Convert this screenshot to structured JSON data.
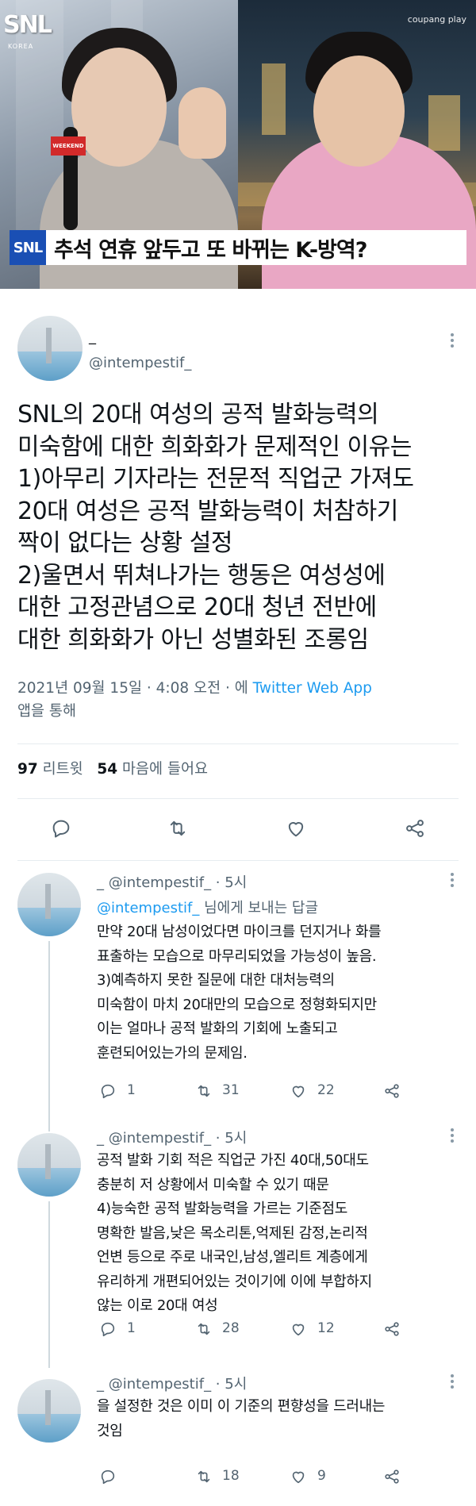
{
  "header_image": {
    "show_logo": "SNL",
    "show_logo_sub": "KOREA",
    "platform_watermark": "coupang play",
    "mic_flag": "WEEKEND",
    "caption_badge": "SNL",
    "caption": "추석 연휴 앞두고 또 바뀌는 K-방역?"
  },
  "tweet": {
    "display_name": "_",
    "handle": "@intempestif_",
    "text_lines": [
      "SNL의 20대 여성의 공적 발화능력의",
      "미숙함에 대한 희화화가 문제적인 이유는",
      "1)아무리 기자라는 전문적 직업군 가져도",
      "20대 여성은 공적 발화능력이 처참하기",
      "짝이 없다는 상황 설정",
      "2)울면서 뛰쳐나가는 행동은 여성성에",
      "대한 고정관념으로 20대 청년 전반에",
      "대한 희화화가 아닌 성별화된 조롱임"
    ],
    "timestamp": "2021년 09월 15일 · 4:08 오전 · 에",
    "app": "Twitter Web App",
    "app_suffix": "앱을 통해",
    "retweets": "97",
    "retweets_label": "리트윗",
    "likes": "54",
    "likes_label": "마음에 들어요"
  },
  "replies": [
    {
      "header": "_ @intempestif_ · 5시",
      "reply_to_mention": "@intempestif_",
      "reply_to_suffix": "님에게 보내는 답글",
      "lines": [
        "만약 20대 남성이었다면 마이크를 던지거나 화를",
        "표출하는 모습으로 마무리되었을 가능성이 높음.",
        "3)예측하지 못한 질문에 대한 대처능력의",
        "미숙함이 마치 20대만의 모습으로 정형화되지만",
        "이는 얼마나 공적 발화의 기회에 노출되고",
        "훈련되어있는가의 문제임."
      ],
      "replies": "1",
      "retweets": "31",
      "likes": "22"
    },
    {
      "header": "_ @intempestif_ · 5시",
      "lines": [
        "공적 발화 기회 적은 직업군 가진 40대,50대도",
        "충분히 저 상황에서 미숙할 수 있기 때문",
        "4)능숙한 공적 발화능력을 가르는 기준점도",
        "명확한 발음,낮은 목소리톤,억제된 감정,논리적",
        "언변 등으로 주로 내국인,남성,엘리트 계층에게",
        "유리하게 개편되어있는 것이기에 이에 부합하지",
        "않는 이로 20대 여성"
      ],
      "replies": "1",
      "retweets": "28",
      "likes": "12"
    },
    {
      "header": "_ @intempestif_ · 5시",
      "lines": [
        "을 설정한 것은 이미 이 기준의 편향성을 드러내는",
        "것임"
      ],
      "replies": "",
      "retweets": "18",
      "likes": "9"
    }
  ],
  "colors": {
    "accent": "#1d9bf0",
    "text_primary": "#0f1419",
    "text_secondary": "#536471",
    "divider": "#e6ecf0"
  },
  "icons": [
    "more-icon",
    "reply-icon",
    "retweet-icon",
    "like-icon",
    "share-icon"
  ]
}
